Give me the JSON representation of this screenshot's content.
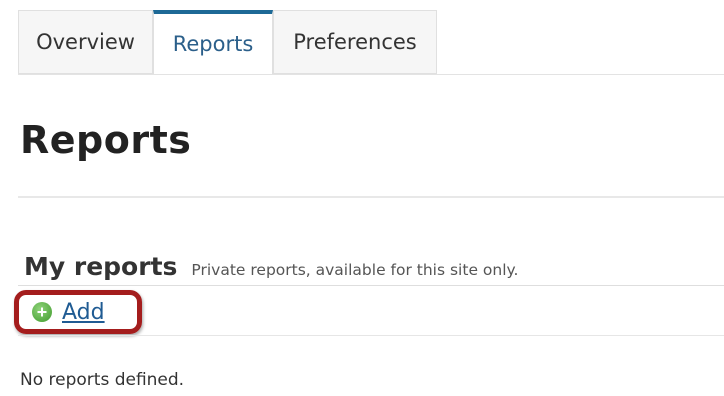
{
  "tabs": [
    {
      "label": "Overview"
    },
    {
      "label": "Reports"
    },
    {
      "label": "Preferences"
    }
  ],
  "page_title": "Reports",
  "section": {
    "title": "My reports",
    "description": "Private reports, available for this site only.",
    "add_label": "Add",
    "add_icon": "add-circle-icon",
    "empty_text": "No reports defined."
  },
  "colors": {
    "active_tab_border": "#1d6996",
    "link": "#1f5b93",
    "highlight": "#a41d1d",
    "add_icon": "#4caf3a"
  }
}
